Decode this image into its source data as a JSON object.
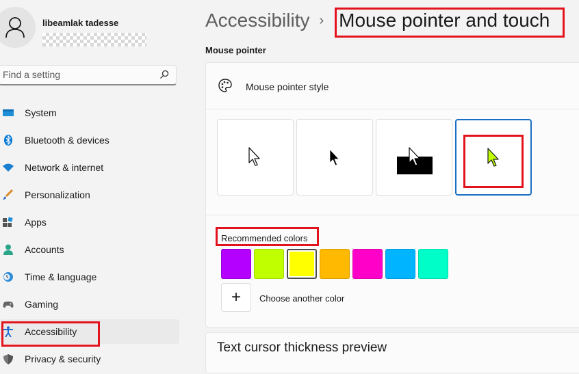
{
  "user": {
    "name": "libeamlak tadesse"
  },
  "search": {
    "placeholder": "Find a setting"
  },
  "nav": {
    "items": [
      {
        "label": "System",
        "icon": "monitor-icon"
      },
      {
        "label": "Bluetooth & devices",
        "icon": "bluetooth-icon"
      },
      {
        "label": "Network & internet",
        "icon": "wifi-icon"
      },
      {
        "label": "Personalization",
        "icon": "brush-icon"
      },
      {
        "label": "Apps",
        "icon": "apps-icon"
      },
      {
        "label": "Accounts",
        "icon": "person-icon"
      },
      {
        "label": "Time & language",
        "icon": "clock-globe-icon"
      },
      {
        "label": "Gaming",
        "icon": "gamepad-icon"
      },
      {
        "label": "Accessibility",
        "icon": "accessibility-icon"
      },
      {
        "label": "Privacy & security",
        "icon": "shield-icon"
      }
    ],
    "active": "Accessibility"
  },
  "breadcrumb": {
    "parent": "Accessibility",
    "separator": "›",
    "current": "Mouse pointer and touch"
  },
  "main": {
    "section_title": "Mouse pointer",
    "pointer_style_label": "Mouse pointer style",
    "pointer_styles": [
      "white",
      "black",
      "inverted",
      "custom"
    ],
    "selected_style": "custom",
    "custom_pointer_color": "#c0ff00",
    "recommended_colors_label": "Recommended colors",
    "colors": [
      "#b300ff",
      "#c0ff00",
      "#ffff00",
      "#ffb900",
      "#ff00c8",
      "#00b4ff",
      "#00ffc8"
    ],
    "selected_color": "#ffff00",
    "choose_another_label": "Choose another color",
    "add_icon": "plus-icon",
    "next_card_title": "Text cursor thickness preview"
  },
  "colors": {
    "highlight": "#e3131d",
    "accent": "#1a6fc4"
  }
}
